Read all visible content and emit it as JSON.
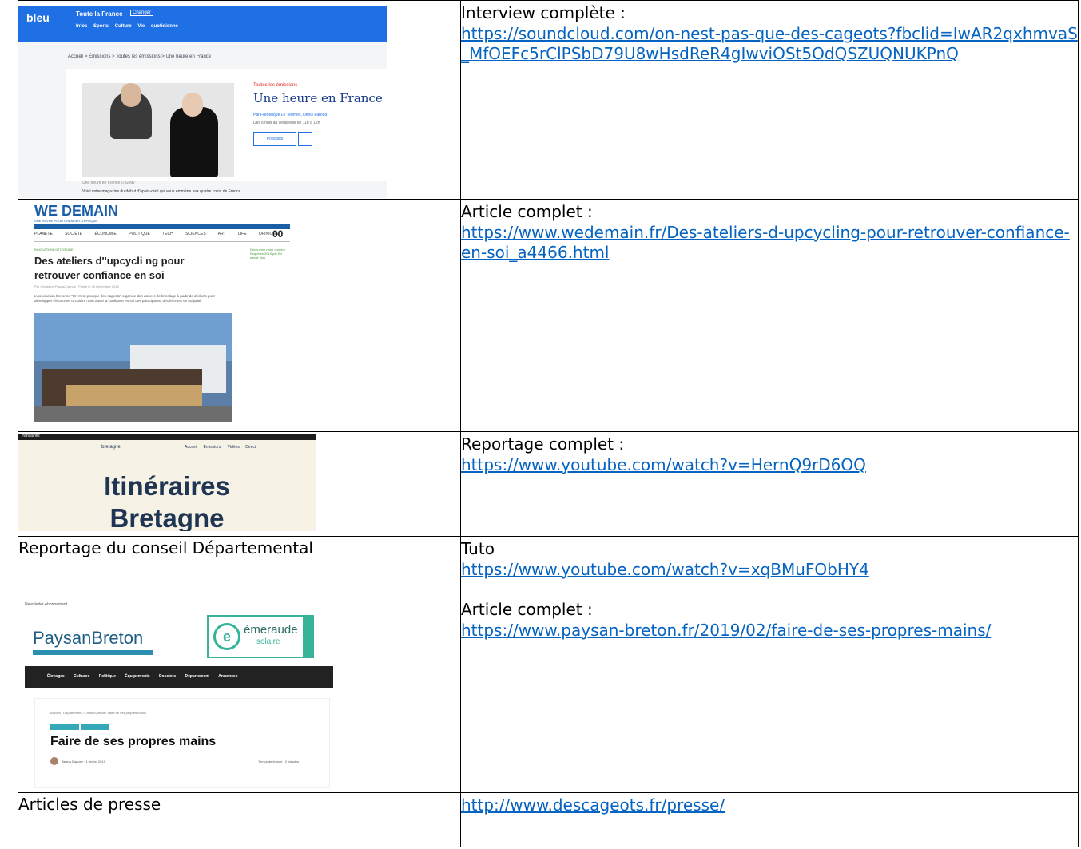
{
  "rows": [
    {
      "right_label": "Interview complète :",
      "link": "https://soundcloud.com/on-nest-pas-que-des-cageots?fbclid=IwAR2qxhmvaS_MfOEFc5rClPSbD79U8wHsdReR4gIwviOSt5OdQSZUQNUKPnQ",
      "shot": {
        "brand": "bleu",
        "region": "Toute la France",
        "change": "Changer",
        "nav": "Infos Sports Culture Vie quotidienne",
        "breadcrumb": "Accueil > Émissions > Toutes les émissions > Une heure en France",
        "section": "Toutes les émissions",
        "title": "Une heure en France",
        "by": "Par Frédérique Le Teurnier, Denis Faroud",
        "hours": "Des lundis au vendredis de 11h à 12h",
        "button": "Podcasts",
        "caption": "Une heure en France © Getty",
        "desc": "Voici votre magazine du début d'après-midi qui vous emmène aux quatre coins de France."
      }
    },
    {
      "right_label": "Article complet :",
      "link": "https://www.wedemain.fr/Des-ateliers-d-upcycling-pour-retrouver-confiance-en-soi_a4466.html",
      "shot": {
        "logo": "WE DEMAIN",
        "tagline": "UNE REVUE POUR CHANGER D'ÉPOQUE",
        "menu": "PLANÈTE SOCIÉTÉ ÉCONOMIE POLITIQUE TECH SCIENCES ART LIFE OPINIONS",
        "oo": "00",
        "category": "INNOVATION CITOYENNE",
        "headline": "Des ateliers d''upcycli ng pour retrouver confiance en soi",
        "meta": "Par Géraldine Pascal-Damon | Publié le 20 Décembre 2019",
        "paragraph": "L'association bretonne \"On n'est pas que des cageots\" organise des ateliers de bricolage à partir de déchets pour développer l'économie circulaire mais aussi la confiance en soi des participants, des femmes en majorité.",
        "side": "Découvrez notre numéro Enquêtes 2019 par En savoir plus"
      }
    },
    {
      "right_label": "Reportage complet :",
      "link": "https://www.youtube.com/watch?v=HernQ9rD6OQ",
      "shot": {
        "bar": "francainfo:",
        "channel": "bretagne",
        "icons": "Accueil Émissions Vidéos Direct",
        "title_line1": "Itinéraires",
        "title_line2": "Bretagne"
      }
    },
    {
      "left_text": "Reportage du conseil Départemental",
      "right_label": "Tuto",
      "link": "https://www.youtube.com/watch?v=xqBMuFObHY4"
    },
    {
      "right_label": "Article complet :",
      "link": "https://www.paysan-breton.fr/2019/02/faire-de-ses-propres-mains/",
      "shot": {
        "top": "Newsletter Abonnement",
        "logo": "PaysanBreton",
        "ad_title": "émeraude",
        "ad_sub": "solaire",
        "nav": "Élevages Cultures Politique Équipements Dossiers Département Annonces",
        "crumb": "Accueil / Département / Côtes d'Armor / Faire de ses propres mains",
        "headline": "Faire de ses propres mains",
        "author": "Tanina Daguen · 1 février 2019",
        "reading": "Temps de lecture : 2 minutes"
      }
    },
    {
      "left_text": "Articles de presse",
      "link": "http://www.descageots.fr/presse/"
    }
  ]
}
